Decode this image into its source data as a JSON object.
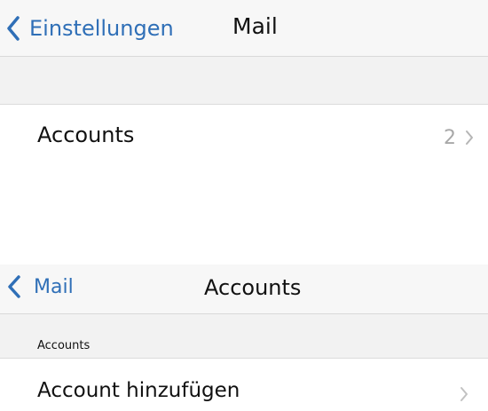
{
  "mail_settings": {
    "nav": {
      "back_label": "Einstellungen",
      "title": "Mail"
    },
    "accounts_row": {
      "label": "Accounts",
      "count": "2"
    }
  },
  "accounts_screen": {
    "nav": {
      "back_label": "Mail",
      "title": "Accounts"
    },
    "section_header": "Accounts",
    "add_account_row": {
      "label": "Account hinzufügen"
    }
  },
  "icons": {
    "back": "chevron-left-icon",
    "disclosure": "chevron-right-icon"
  },
  "colors": {
    "accent": "#2f6fb7",
    "nav_background": "#f7f7f7",
    "group_background": "#f2f2f2",
    "secondary_text": "#a8a8a8"
  }
}
